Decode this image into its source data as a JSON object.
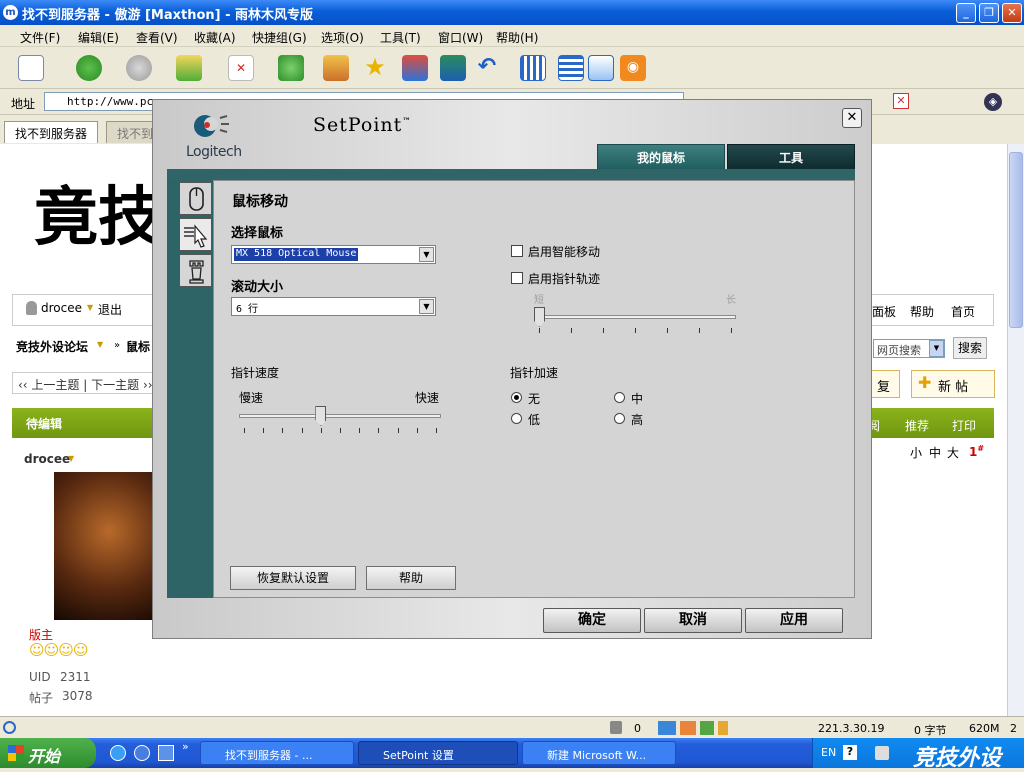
{
  "browser": {
    "title": "找不到服务器 - 傲游 [Maxthon] - 雨林木风专版",
    "menu": [
      "文件(F)",
      "编辑(E)",
      "查看(V)",
      "收藏(A)",
      "快捷组(G)",
      "选项(O)",
      "工具(T)",
      "窗口(W)",
      "帮助(H)"
    ],
    "address_label": "地址",
    "address_value": "http://www.pcw",
    "tabs": [
      "找不到服务器",
      "找不到"
    ]
  },
  "forum": {
    "heading": "竟技",
    "user": "drocee",
    "logout": "退出",
    "breadcrumb_home": "竞技外设论坛",
    "breadcrumb_next": "鼠标",
    "prev_thread": "上一主题",
    "next_thread": "下一主题",
    "pending": "待编辑",
    "poster": "drocee",
    "role": "版主",
    "uid_label": "UID",
    "uid_value": "2311",
    "posts_label": "帖子",
    "posts_value": "3078",
    "right_links": [
      "面板",
      "帮助",
      "首页"
    ],
    "search_option": "网页搜索",
    "search_button": "搜索",
    "reply_button": "复",
    "new_post_button": "新 帖",
    "action_links": [
      "阅",
      "推荐",
      "打印"
    ],
    "font_sizes": [
      "小",
      "中",
      "大"
    ],
    "floor": "1"
  },
  "status": {
    "count": "0",
    "ip": "221.3.30.19",
    "bytes": "0 字节",
    "memory": "620M",
    "tabs_count": "2"
  },
  "taskbar": {
    "start": "开始",
    "tasks": [
      "找不到服务器 - ...",
      "SetPoint 设置",
      "新建 Microsoft W..."
    ],
    "lang": "EN",
    "watermark": "竞技外设"
  },
  "dialog": {
    "brand": "Logitech",
    "title": "SetPoint",
    "tabs": {
      "mouse": "我的鼠标",
      "tools": "工具"
    },
    "section_title": "鼠标移动",
    "select_mouse_label": "选择鼠标",
    "select_mouse_value": "MX 518 Optical Mouse",
    "scroll_label": "滚动大小",
    "scroll_value": "6  行",
    "smart_move_label": "启用智能移动",
    "trail_label": "启用指针轨迹",
    "trail_short": "短",
    "trail_long": "长",
    "trail_level": 0,
    "speed_label": "指针速度",
    "speed_slow": "慢速",
    "speed_fast": "快速",
    "speed_level": 0.4,
    "accel_label": "指针加速",
    "accel_options": [
      "无",
      "中",
      "低",
      "高"
    ],
    "accel_selected": "无",
    "restore_button": "恢复默认设置",
    "help_button": "帮助",
    "ok_button": "确定",
    "cancel_button": "取消",
    "apply_button": "应用"
  }
}
